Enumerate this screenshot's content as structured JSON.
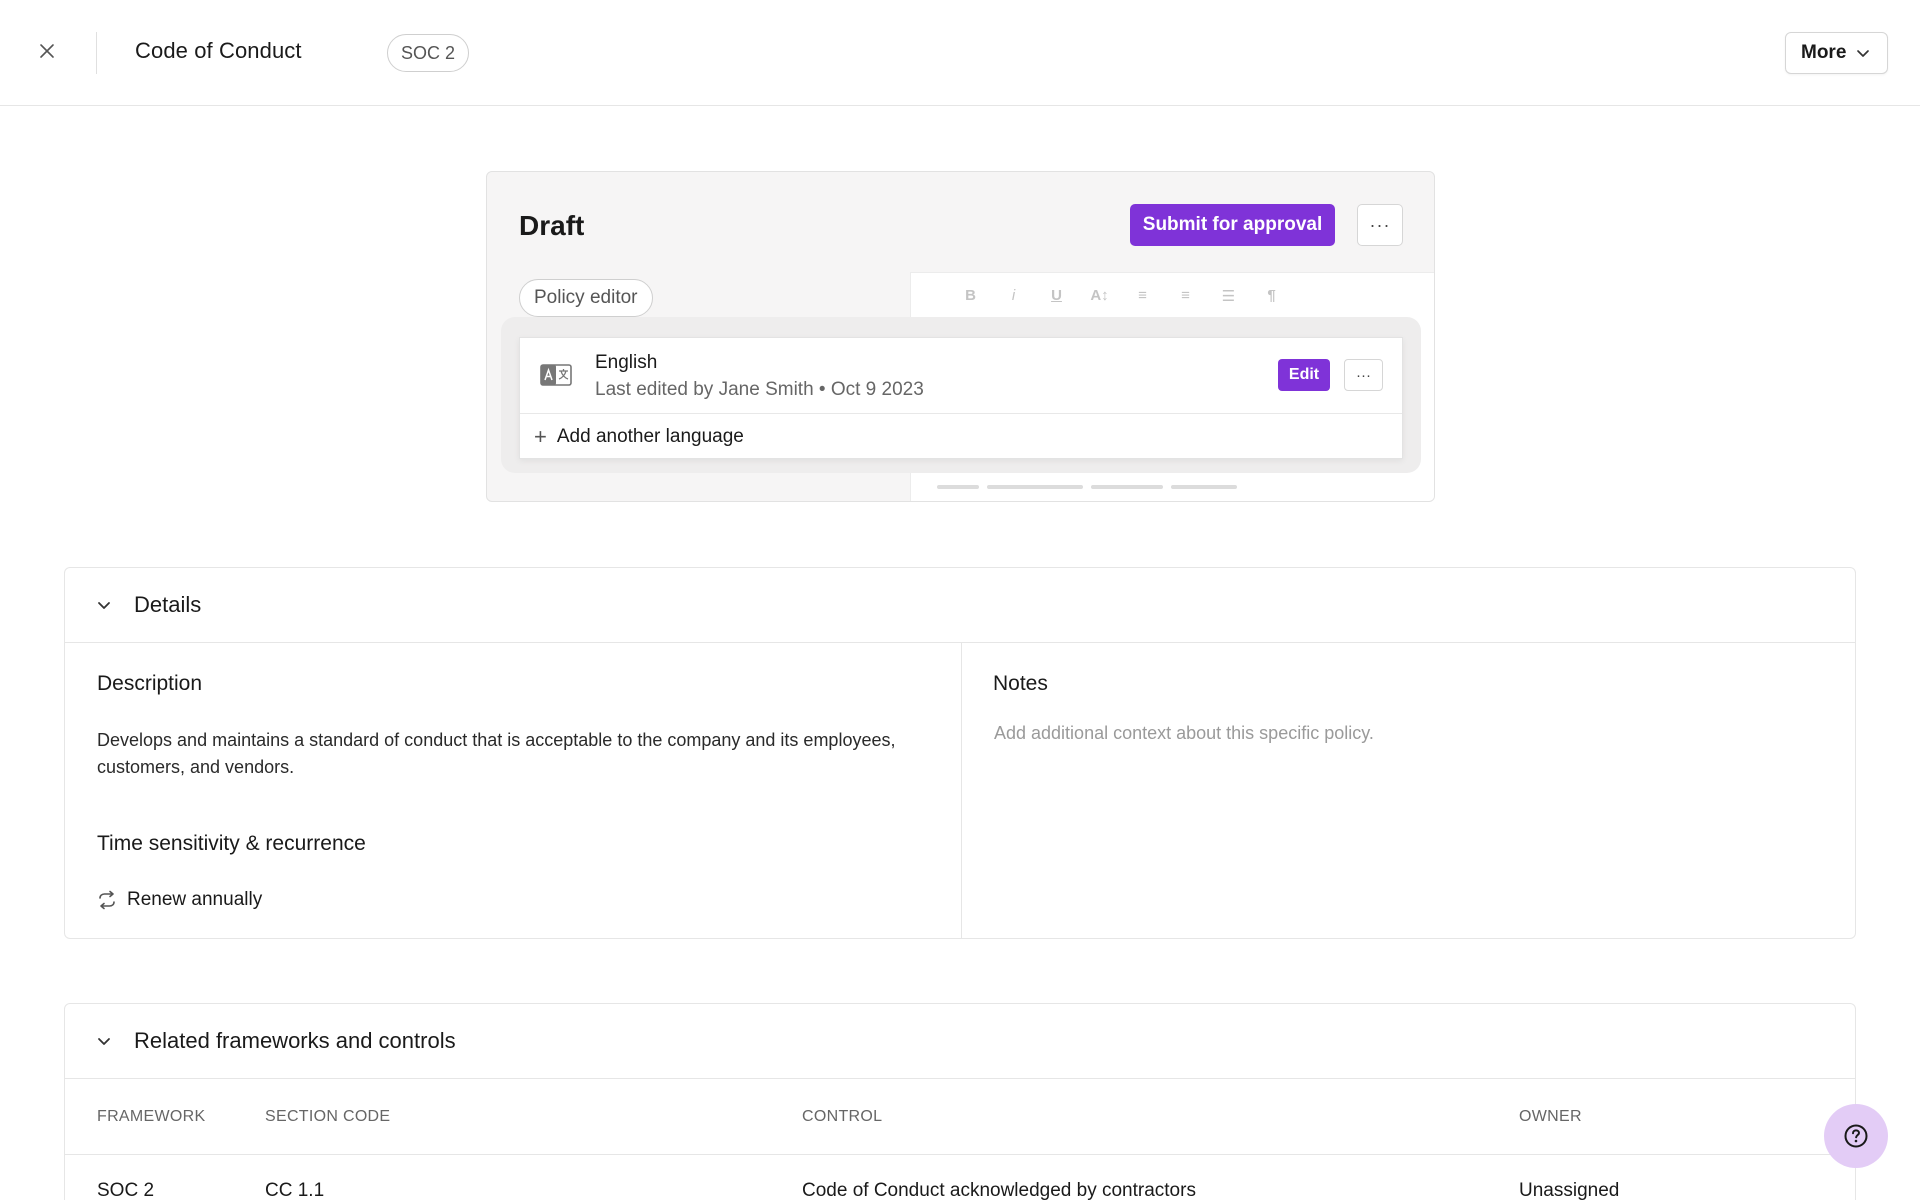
{
  "header": {
    "title": "Code of Conduct",
    "framework_tag": "SOC 2",
    "more_label": "More"
  },
  "draft": {
    "title": "Draft",
    "submit_label": "Submit for approval",
    "more_label": "···",
    "editor_pill": "Policy editor",
    "toolbar": [
      "B",
      "i",
      "U",
      "A↕",
      "≡",
      "≡",
      "☰",
      "¶"
    ],
    "language": {
      "name": "English",
      "meta": "Last edited by Jane Smith • Oct 9 2023",
      "edit_label": "Edit",
      "more_label": "···"
    },
    "add_language_label": "Add another language"
  },
  "details": {
    "title": "Details",
    "description_title": "Description",
    "description_text": "Develops and maintains a standard of conduct that is acceptable to the company and its employees, customers, and vendors.",
    "notes_title": "Notes",
    "notes_placeholder": "Add additional context about this specific policy.",
    "recurrence_title": "Time sensitivity & recurrence",
    "recurrence_value": "Renew annually"
  },
  "related": {
    "title": "Related frameworks and controls",
    "columns": [
      "FRAMEWORK",
      "SECTION CODE",
      "CONTROL",
      "OWNER"
    ],
    "rows": [
      [
        "SOC 2",
        "CC 1.1",
        "Code of Conduct acknowledged by contractors",
        "Unassigned"
      ]
    ]
  },
  "colors": {
    "accent": "#7f33d8",
    "help_bg": "#e3ccf6"
  }
}
